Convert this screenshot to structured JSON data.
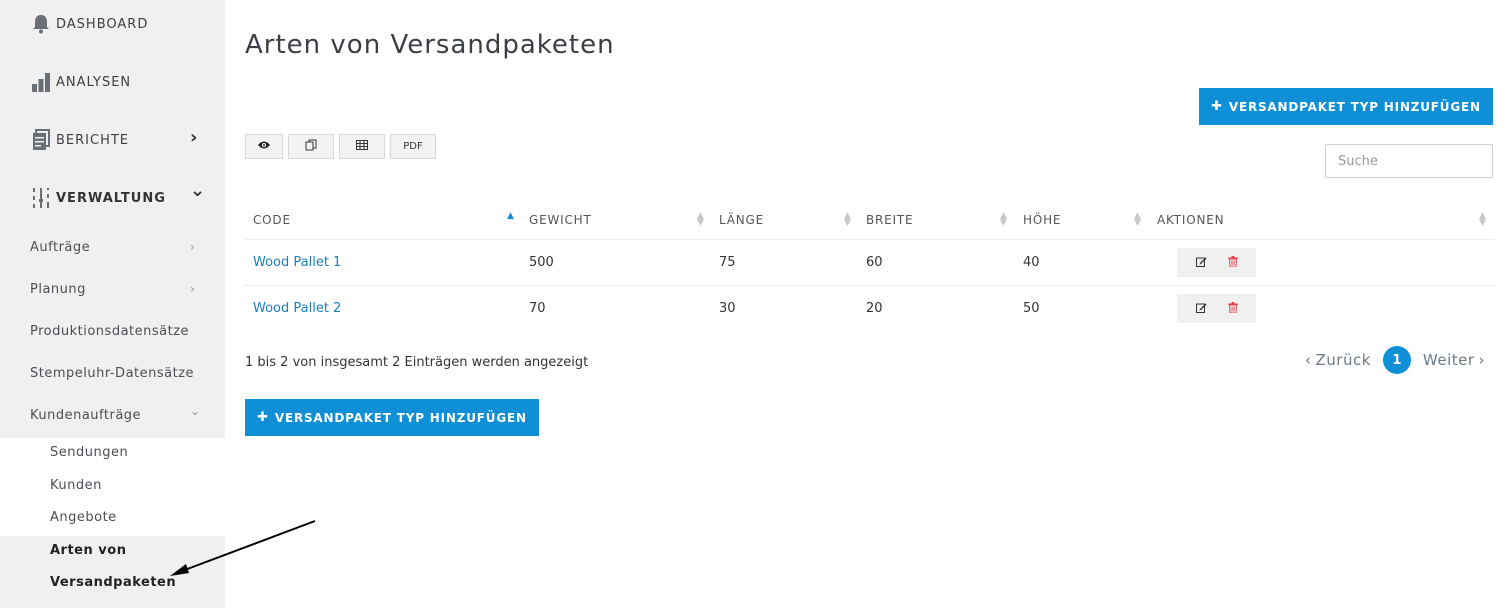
{
  "sidebar": {
    "top_items": [
      {
        "label": "DASHBOARD",
        "icon": "bell-icon"
      },
      {
        "label": "ANALYSEN",
        "icon": "bar-chart-icon"
      },
      {
        "label": "BERICHTE",
        "icon": "document-icon",
        "chevron": "›"
      },
      {
        "label": "VERWALTUNG",
        "icon": "sliders-icon",
        "chevron": "⌄"
      }
    ],
    "sub_items": [
      {
        "label": "Aufträge",
        "chevron": "›"
      },
      {
        "label": "Planung",
        "chevron": "›"
      },
      {
        "label": "Produktionsdatensätze"
      },
      {
        "label": "Stempeluhr-Datensätze"
      },
      {
        "label": "Kundenaufträge",
        "chevron": "⌄"
      }
    ],
    "subsub_items": [
      {
        "label": "Sendungen"
      },
      {
        "label": "Kunden"
      },
      {
        "label": "Angebote"
      }
    ],
    "active_item": {
      "line1": "Arten von",
      "line2": "Versandpaketen"
    }
  },
  "main": {
    "title": "Arten von Versandpaketen",
    "add_button_label": "VERSANDPAKET TYP HINZUFÜGEN",
    "add_button_plus": "✚",
    "toolbar": {
      "pdf_label": "PDF"
    },
    "search": {
      "placeholder": "Suche"
    },
    "table": {
      "columns": [
        "CODE",
        "GEWICHT",
        "LÄNGE",
        "BREITE",
        "HÖHE",
        "AKTIONEN"
      ],
      "rows": [
        {
          "code": "Wood Pallet 1",
          "gewicht": "500",
          "laenge": "75",
          "breite": "60",
          "hoehe": "40"
        },
        {
          "code": "Wood Pallet 2",
          "gewicht": "70",
          "laenge": "30",
          "breite": "20",
          "hoehe": "50"
        }
      ]
    },
    "info_text": "1 bis 2 von insgesamt 2 Einträgen werden angezeigt",
    "pagination": {
      "prev": "Zurück",
      "current": "1",
      "next": "Weiter"
    }
  },
  "colors": {
    "accent": "#0e8fd6",
    "link": "#1a7fc1",
    "sidebar_bg": "#f0f0f0",
    "delete_icon": "#e0454d"
  }
}
